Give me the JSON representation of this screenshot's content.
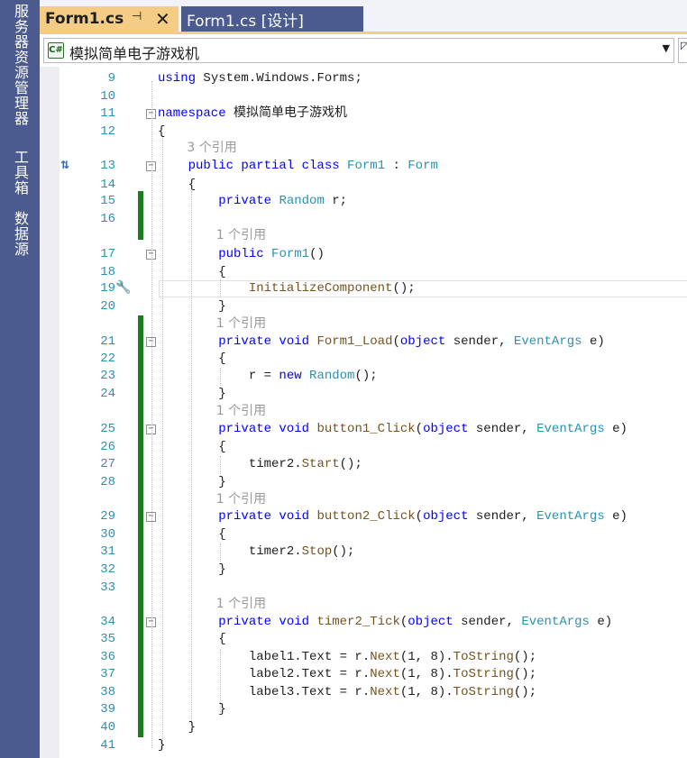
{
  "side_tabs": [
    "服务器资源管理器",
    "工具箱",
    "数据源"
  ],
  "tabs": [
    {
      "label": "Form1.cs",
      "pin_icon": "pin-icon",
      "close_icon": "close-icon",
      "active": true
    },
    {
      "label": "Form1.cs [设计]",
      "active": false
    }
  ],
  "nav": {
    "language_badge": "C#",
    "selected": "模拟简单电子游戏机"
  },
  "colors": {
    "keyword": "#0000ff",
    "type": "#2b91af",
    "text": "#1e1e1e",
    "codelens": "#999999",
    "changed_line_bar": "#1d7a1d",
    "active_tab": "#f5cc84",
    "side_strip": "#4b5a8f"
  },
  "line_numbers": [
    "9",
    "10",
    "11",
    "12",
    "13",
    "14",
    "15",
    "16",
    "17",
    "18",
    "19",
    "20",
    "21",
    "22",
    "23",
    "24",
    "25",
    "26",
    "27",
    "28",
    "29",
    "30",
    "31",
    "32",
    "33",
    "34",
    "35",
    "36",
    "37",
    "38",
    "39",
    "40",
    "41"
  ],
  "code_lines": [
    {
      "ln": "9",
      "tokens": [
        [
          "k",
          "using"
        ],
        [
          "s",
          " System.Windows.Forms;"
        ]
      ]
    },
    {
      "ln": "11",
      "tokens": [
        [
          "k",
          "namespace"
        ],
        [
          "s",
          " 模拟简单电子游戏机"
        ]
      ]
    },
    {
      "ln": "12",
      "tokens": [
        [
          "s",
          "{"
        ]
      ]
    },
    {
      "ln": "13",
      "tokens": [
        [
          "s",
          "    "
        ],
        [
          "k",
          "public partial class"
        ],
        [
          "s",
          " "
        ],
        [
          "t",
          "Form1"
        ],
        [
          "s",
          " : "
        ],
        [
          "t",
          "Form"
        ]
      ]
    },
    {
      "ln": "14",
      "tokens": [
        [
          "s",
          "    {"
        ]
      ]
    },
    {
      "ln": "15",
      "tokens": [
        [
          "s",
          "        "
        ],
        [
          "k",
          "private"
        ],
        [
          "s",
          " "
        ],
        [
          "t",
          "Random"
        ],
        [
          "s",
          " r;"
        ]
      ]
    },
    {
      "ln": "17",
      "tokens": [
        [
          "s",
          "        "
        ],
        [
          "k",
          "public"
        ],
        [
          "s",
          " "
        ],
        [
          "t",
          "Form1"
        ],
        [
          "s",
          "()"
        ]
      ]
    },
    {
      "ln": "18",
      "tokens": [
        [
          "s",
          "        {"
        ]
      ]
    },
    {
      "ln": "19",
      "tokens": [
        [
          "s",
          "            "
        ],
        [
          "m",
          "InitializeComponent"
        ],
        [
          "s",
          "();"
        ]
      ]
    },
    {
      "ln": "20",
      "tokens": [
        [
          "s",
          "        }"
        ]
      ]
    },
    {
      "ln": "21",
      "tokens": [
        [
          "s",
          "        "
        ],
        [
          "k",
          "private void"
        ],
        [
          "s",
          " "
        ],
        [
          "m",
          "Form1_Load"
        ],
        [
          "s",
          "("
        ],
        [
          "k",
          "object"
        ],
        [
          "s",
          " sender, "
        ],
        [
          "t",
          "EventArgs"
        ],
        [
          "s",
          " e)"
        ]
      ]
    },
    {
      "ln": "22",
      "tokens": [
        [
          "s",
          "        {"
        ]
      ]
    },
    {
      "ln": "23",
      "tokens": [
        [
          "s",
          "            r = "
        ],
        [
          "k",
          "new"
        ],
        [
          "s",
          " "
        ],
        [
          "t",
          "Random"
        ],
        [
          "s",
          "();"
        ]
      ]
    },
    {
      "ln": "24",
      "tokens": [
        [
          "s",
          "        }"
        ]
      ]
    },
    {
      "ln": "25",
      "tokens": [
        [
          "s",
          "        "
        ],
        [
          "k",
          "private void"
        ],
        [
          "s",
          " "
        ],
        [
          "m",
          "button1_Click"
        ],
        [
          "s",
          "("
        ],
        [
          "k",
          "object"
        ],
        [
          "s",
          " sender, "
        ],
        [
          "t",
          "EventArgs"
        ],
        [
          "s",
          " e)"
        ]
      ]
    },
    {
      "ln": "26",
      "tokens": [
        [
          "s",
          "        {"
        ]
      ]
    },
    {
      "ln": "27",
      "tokens": [
        [
          "s",
          "            timer2."
        ],
        [
          "m",
          "Start"
        ],
        [
          "s",
          "();"
        ]
      ]
    },
    {
      "ln": "28",
      "tokens": [
        [
          "s",
          "        }"
        ]
      ]
    },
    {
      "ln": "29",
      "tokens": [
        [
          "s",
          "        "
        ],
        [
          "k",
          "private void"
        ],
        [
          "s",
          " "
        ],
        [
          "m",
          "button2_Click"
        ],
        [
          "s",
          "("
        ],
        [
          "k",
          "object"
        ],
        [
          "s",
          " sender, "
        ],
        [
          "t",
          "EventArgs"
        ],
        [
          "s",
          " e)"
        ]
      ]
    },
    {
      "ln": "30",
      "tokens": [
        [
          "s",
          "        {"
        ]
      ]
    },
    {
      "ln": "31",
      "tokens": [
        [
          "s",
          "            timer2."
        ],
        [
          "m",
          "Stop"
        ],
        [
          "s",
          "();"
        ]
      ]
    },
    {
      "ln": "32",
      "tokens": [
        [
          "s",
          "        }"
        ]
      ]
    },
    {
      "ln": "34",
      "tokens": [
        [
          "s",
          "        "
        ],
        [
          "k",
          "private void"
        ],
        [
          "s",
          " "
        ],
        [
          "m",
          "timer2_Tick"
        ],
        [
          "s",
          "("
        ],
        [
          "k",
          "object"
        ],
        [
          "s",
          " sender, "
        ],
        [
          "t",
          "EventArgs"
        ],
        [
          "s",
          " e)"
        ]
      ]
    },
    {
      "ln": "35",
      "tokens": [
        [
          "s",
          "        {"
        ]
      ]
    },
    {
      "ln": "36",
      "tokens": [
        [
          "s",
          "            label1.Text = r."
        ],
        [
          "m",
          "Next"
        ],
        [
          "s",
          "(1, 8)."
        ],
        [
          "m",
          "ToString"
        ],
        [
          "s",
          "();"
        ]
      ]
    },
    {
      "ln": "37",
      "tokens": [
        [
          "s",
          "            label2.Text = r."
        ],
        [
          "m",
          "Next"
        ],
        [
          "s",
          "(1, 8)."
        ],
        [
          "m",
          "ToString"
        ],
        [
          "s",
          "();"
        ]
      ]
    },
    {
      "ln": "38",
      "tokens": [
        [
          "s",
          "            label3.Text = r."
        ],
        [
          "m",
          "Next"
        ],
        [
          "s",
          "(1, 8)."
        ],
        [
          "m",
          "ToString"
        ],
        [
          "s",
          "();"
        ]
      ]
    },
    {
      "ln": "39",
      "tokens": [
        [
          "s",
          "        }"
        ]
      ]
    },
    {
      "ln": "40",
      "tokens": [
        [
          "s",
          "    }"
        ]
      ]
    },
    {
      "ln": "41",
      "tokens": [
        [
          "s",
          "}"
        ]
      ]
    }
  ],
  "codelens": [
    {
      "before_ln": "13",
      "text": "3 个引用"
    },
    {
      "before_ln": "17",
      "text": "1 个引用"
    },
    {
      "before_ln": "21",
      "text": "1 个引用"
    },
    {
      "before_ln": "25",
      "text": "1 个引用"
    },
    {
      "before_ln": "29",
      "text": "1 个引用"
    },
    {
      "before_ln": "34",
      "text": "1 个引用"
    }
  ],
  "foldable_lines": [
    "11",
    "13",
    "17",
    "21",
    "25",
    "29",
    "34"
  ],
  "icons": {
    "implementation_glyph": "implementation-icon",
    "quick_action": "wrench-icon",
    "language": "csharp-icon"
  }
}
